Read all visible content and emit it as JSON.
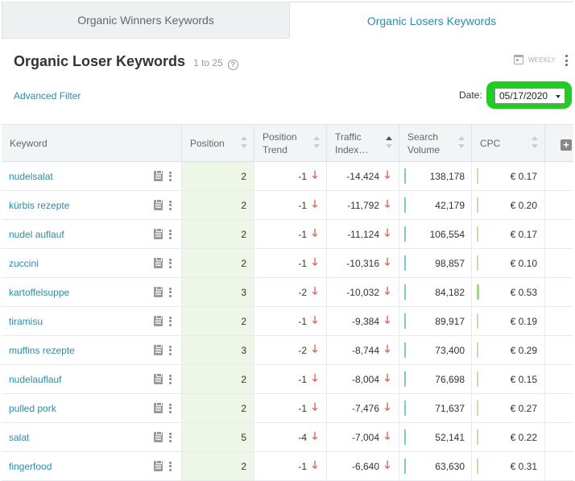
{
  "tabs": [
    {
      "label": "Organic Winners Keywords",
      "active": false
    },
    {
      "label": "Organic Losers Keywords",
      "active": true
    }
  ],
  "header": {
    "title": "Organic Loser Keywords",
    "range": "1 to 25",
    "help_icon": "?",
    "weekly_label": "WEEKLY"
  },
  "filters": {
    "advanced_filter": "Advanced Filter",
    "date_label": "Date:",
    "date_value": "05/17/2020",
    "highlight_color": "#22cc22"
  },
  "columns": {
    "keyword": "Keyword",
    "position": "Position",
    "position_trend": "Position Trend",
    "traffic_index": "Traffic Index…",
    "search_volume": "Search Volume",
    "cpc": "CPC"
  },
  "add_column_icon": "+",
  "rows": [
    {
      "keyword": "nudelsalat",
      "position": "2",
      "trend": "-1",
      "traffic": "-14,424",
      "volume": "138,178",
      "cpc": "€ 0.17"
    },
    {
      "keyword": "kürbis rezepte",
      "position": "2",
      "trend": "-1",
      "traffic": "-11,792",
      "volume": "42,179",
      "cpc": "€ 0.20"
    },
    {
      "keyword": "nudel auflauf",
      "position": "2",
      "trend": "-1",
      "traffic": "-11,124",
      "volume": "106,554",
      "cpc": "€ 0.17"
    },
    {
      "keyword": "zuccini",
      "position": "2",
      "trend": "-1",
      "traffic": "-10,316",
      "volume": "98,857",
      "cpc": "€ 0.10"
    },
    {
      "keyword": "kartoffelsuppe",
      "position": "3",
      "trend": "-2",
      "traffic": "-10,032",
      "volume": "84,182",
      "cpc": "€ 0.53"
    },
    {
      "keyword": "tiramisu",
      "position": "2",
      "trend": "-1",
      "traffic": "-9,384",
      "volume": "89,917",
      "cpc": "€ 0.19"
    },
    {
      "keyword": "muffins rezepte",
      "position": "3",
      "trend": "-2",
      "traffic": "-8,744",
      "volume": "73,400",
      "cpc": "€ 0.29"
    },
    {
      "keyword": "nudelauflauf",
      "position": "2",
      "trend": "-1",
      "traffic": "-8,004",
      "volume": "76,698",
      "cpc": "€ 0.15"
    },
    {
      "keyword": "pulled pork",
      "position": "2",
      "trend": "-1",
      "traffic": "-7,476",
      "volume": "71,637",
      "cpc": "€ 0.27"
    },
    {
      "keyword": "salat",
      "position": "5",
      "trend": "-4",
      "traffic": "-7,004",
      "volume": "52,141",
      "cpc": "€ 0.22"
    },
    {
      "keyword": "fingerfood",
      "position": "2",
      "trend": "-1",
      "traffic": "-6,640",
      "volume": "63,630",
      "cpc": "€ 0.31"
    }
  ],
  "down_arrow": "🡓"
}
